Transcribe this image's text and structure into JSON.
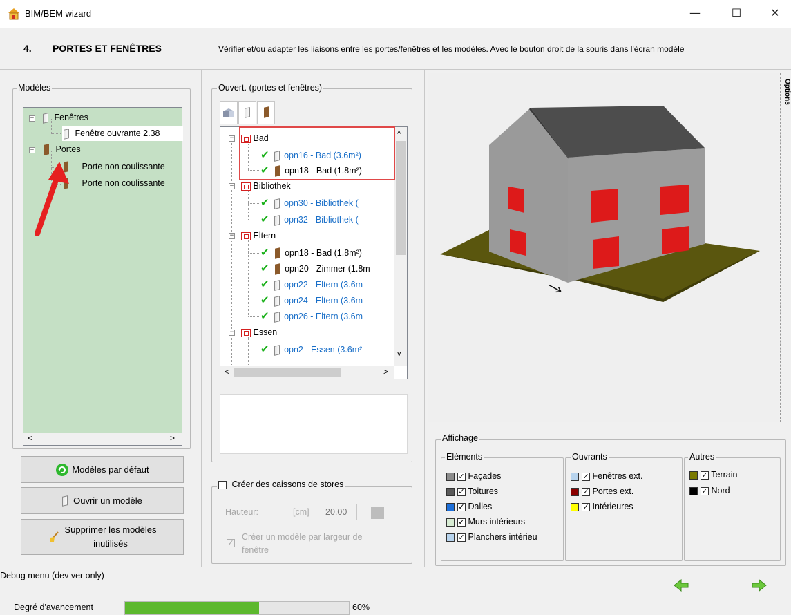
{
  "window": {
    "title": "BIM/BEM wizard",
    "minimize": "—",
    "maximize": "☐",
    "close": "✕"
  },
  "header": {
    "step_number": "4.",
    "step_title": "PORTES ET FENÊTRES",
    "description": "Vérifier et/ou adapter les liaisons entre les portes/fenêtres et les modèles. Avec le bouton droit de la souris dans l'écran modèle"
  },
  "models_panel": {
    "legend": "Modèles",
    "tree": [
      {
        "label": "Fenêtres",
        "expander": "−"
      },
      {
        "label": "Fenêtre ouvrante 2.38"
      },
      {
        "label": "Portes",
        "expander": "−"
      },
      {
        "label": "Porte non coulissante"
      },
      {
        "label": "Porte non coulissante"
      }
    ],
    "buttons": {
      "default_models": "Modèles par défaut",
      "open_model": "Ouvrir un modèle",
      "delete_unused_line1": "Supprimer les modèles",
      "delete_unused_line2": "inutilisés"
    }
  },
  "openings_panel": {
    "legend": "Ouvert. (portes et fenêtres)",
    "groups": [
      {
        "room": "Bad",
        "items": [
          {
            "label": "opn16 - Bad (3.6m²)",
            "type": "window"
          },
          {
            "label": "opn18 - Bad (1.8m²)",
            "type": "door"
          }
        ]
      },
      {
        "room": "Bibliothek",
        "items": [
          {
            "label": "opn30 - Bibliothek (",
            "type": "window"
          },
          {
            "label": "opn32 - Bibliothek (",
            "type": "window"
          }
        ]
      },
      {
        "room": "Eltern",
        "items": [
          {
            "label": "opn18 - Bad (1.8m²)",
            "type": "door"
          },
          {
            "label": "opn20 - Zimmer (1.8m",
            "type": "door"
          },
          {
            "label": "opn22 - Eltern (3.6m",
            "type": "window"
          },
          {
            "label": "opn24 - Eltern (3.6m",
            "type": "window"
          },
          {
            "label": "opn26 - Eltern (3.6m",
            "type": "window"
          }
        ]
      },
      {
        "room": "Essen",
        "items": [
          {
            "label": "opn2 - Essen (3.6m²",
            "type": "window"
          }
        ]
      }
    ],
    "expander": "−",
    "check": "✔"
  },
  "shutters": {
    "checkbox_label": "Créer des caissons de stores",
    "height_label": "Hauteur:",
    "unit": "[cm]",
    "height_value": "20.00",
    "per_width_label_line1": "Créer un modèle par largeur de",
    "per_width_label_line2": "fenêtre",
    "check": "✓"
  },
  "options_tab": "Options",
  "display": {
    "legend": "Affichage",
    "elements": {
      "legend": "Eléments",
      "items": [
        {
          "label": "Façades",
          "color": "#8c8c8c",
          "checked": "✓"
        },
        {
          "label": "Toitures",
          "color": "#5a5a5a",
          "checked": "✓"
        },
        {
          "label": "Dalles",
          "color": "#1e6fd9",
          "checked": "✓"
        },
        {
          "label": "Murs intérieurs",
          "color": "#d8ecd4",
          "checked": "✓"
        },
        {
          "label": "Planchers intérieu",
          "color": "#b8d4ee",
          "checked": "✓"
        }
      ]
    },
    "openings": {
      "legend": "Ouvrants",
      "items": [
        {
          "label": "Fenêtres ext.",
          "color": "#b8d4ee",
          "checked": "✓"
        },
        {
          "label": "Portes ext.",
          "color": "#8b0000",
          "checked": "✓"
        },
        {
          "label": "Intérieures",
          "color": "#ffff00",
          "checked": "✓"
        }
      ]
    },
    "others": {
      "legend": "Autres",
      "items": [
        {
          "label": "Terrain",
          "color": "#7a7a00",
          "checked": "✓"
        },
        {
          "label": "Nord",
          "color": "#000000",
          "checked": "✓"
        }
      ]
    }
  },
  "footer": {
    "debug": "Debug menu (dev ver only)",
    "progress_label": "Degré d'avancement",
    "progress_value": 0.6,
    "progress_text": "60%",
    "back_icon": "arrow-left-icon",
    "next_icon": "arrow-right-icon"
  },
  "colors": {
    "tree_bg": "#c5e0c5",
    "accent_green": "#2eb82e",
    "highlight_red": "#e04848",
    "link_blue": "#1a6fc8"
  }
}
